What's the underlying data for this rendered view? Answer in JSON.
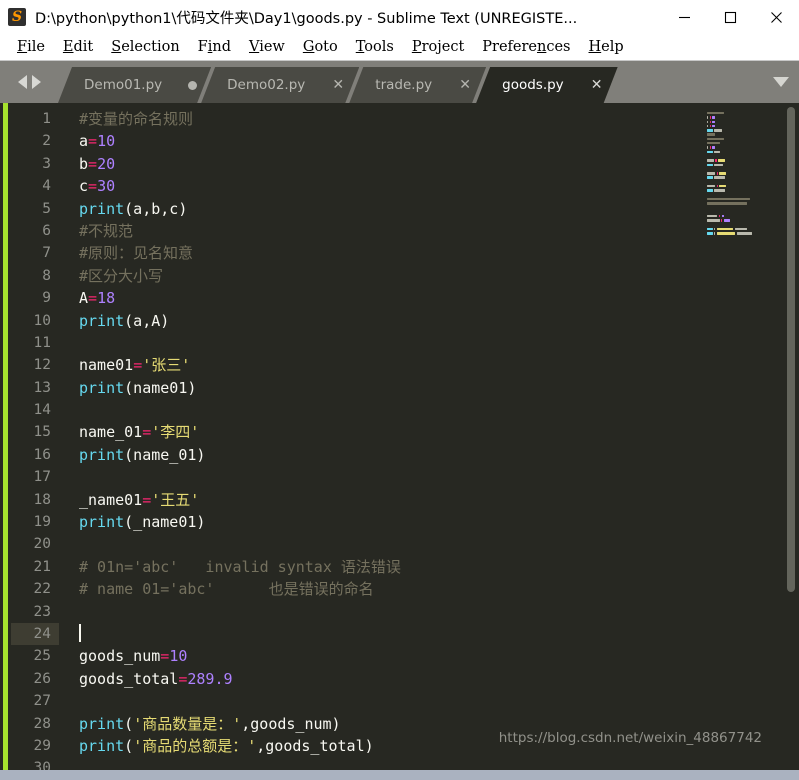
{
  "window": {
    "title": "D:\\python\\python1\\代码文件夹\\Day1\\goods.py - Sublime Text (UNREGISTE...",
    "app_icon": "sublime-text-icon",
    "icon_letter": "S",
    "controls": {
      "minimize": "minimize-icon",
      "maximize": "maximize-icon",
      "close": "close-icon"
    }
  },
  "menubar": {
    "items": [
      {
        "label": "File",
        "mnemonic": "F"
      },
      {
        "label": "Edit",
        "mnemonic": "E"
      },
      {
        "label": "Selection",
        "mnemonic": "S"
      },
      {
        "label": "Find",
        "mnemonic": "i"
      },
      {
        "label": "View",
        "mnemonic": "V"
      },
      {
        "label": "Goto",
        "mnemonic": "G"
      },
      {
        "label": "Tools",
        "mnemonic": "T"
      },
      {
        "label": "Project",
        "mnemonic": "P"
      },
      {
        "label": "Preferences",
        "mnemonic": "n"
      },
      {
        "label": "Help",
        "mnemonic": "H"
      }
    ]
  },
  "tabbar": {
    "nav_prev": "arrow-left-icon",
    "nav_next": "arrow-right-icon",
    "overflow_menu": "chevron-down-icon",
    "tabs": [
      {
        "label": "Demo01.py",
        "active": false,
        "dirty": true,
        "close": ""
      },
      {
        "label": "Demo02.py",
        "active": false,
        "dirty": false,
        "close": "✕"
      },
      {
        "label": "trade.py",
        "active": false,
        "dirty": false,
        "close": "✕"
      },
      {
        "label": "goods.py",
        "active": true,
        "dirty": false,
        "close": "✕"
      }
    ]
  },
  "editor": {
    "language": "Python",
    "cursor_line": 24,
    "first_visible_line": 1,
    "last_visible_line": 30,
    "colors": {
      "background": "#272822",
      "gutter_text": "#8f908a",
      "current_line_gutter": "#3e3d32",
      "accent_green": "#a6e22e",
      "comment": "#75715e",
      "function": "#66d9ef",
      "number": "#ae81ff",
      "operator": "#f92672",
      "string": "#e6db74",
      "text": "#f8f8f2"
    },
    "lines": [
      {
        "n": 1,
        "tokens": [
          {
            "t": "#变量的命名规则",
            "c": "c-com"
          }
        ]
      },
      {
        "n": 2,
        "tokens": [
          {
            "t": "a",
            "c": "c-var"
          },
          {
            "t": "=",
            "c": "c-op"
          },
          {
            "t": "10",
            "c": "c-num"
          }
        ]
      },
      {
        "n": 3,
        "tokens": [
          {
            "t": "b",
            "c": "c-var"
          },
          {
            "t": "=",
            "c": "c-op"
          },
          {
            "t": "20",
            "c": "c-num"
          }
        ]
      },
      {
        "n": 4,
        "tokens": [
          {
            "t": "c",
            "c": "c-var"
          },
          {
            "t": "=",
            "c": "c-op"
          },
          {
            "t": "30",
            "c": "c-num"
          }
        ]
      },
      {
        "n": 5,
        "tokens": [
          {
            "t": "print",
            "c": "c-fn"
          },
          {
            "t": "(a,b,c)",
            "c": "c-var"
          }
        ]
      },
      {
        "n": 6,
        "tokens": [
          {
            "t": "#不规范",
            "c": "c-com"
          }
        ]
      },
      {
        "n": 7,
        "tokens": [
          {
            "t": "#原则：见名知意",
            "c": "c-com"
          }
        ]
      },
      {
        "n": 8,
        "tokens": [
          {
            "t": "#区分大小写",
            "c": "c-com"
          }
        ]
      },
      {
        "n": 9,
        "tokens": [
          {
            "t": "A",
            "c": "c-var"
          },
          {
            "t": "=",
            "c": "c-op"
          },
          {
            "t": "18",
            "c": "c-num"
          }
        ]
      },
      {
        "n": 10,
        "tokens": [
          {
            "t": "print",
            "c": "c-fn"
          },
          {
            "t": "(a,A)",
            "c": "c-var"
          }
        ]
      },
      {
        "n": 11,
        "tokens": []
      },
      {
        "n": 12,
        "tokens": [
          {
            "t": "name01",
            "c": "c-var"
          },
          {
            "t": "=",
            "c": "c-op"
          },
          {
            "t": "'张三'",
            "c": "c-str"
          }
        ]
      },
      {
        "n": 13,
        "tokens": [
          {
            "t": "print",
            "c": "c-fn"
          },
          {
            "t": "(name01)",
            "c": "c-var"
          }
        ]
      },
      {
        "n": 14,
        "tokens": []
      },
      {
        "n": 15,
        "tokens": [
          {
            "t": "name_01",
            "c": "c-var"
          },
          {
            "t": "=",
            "c": "c-op"
          },
          {
            "t": "'李四'",
            "c": "c-str"
          }
        ]
      },
      {
        "n": 16,
        "tokens": [
          {
            "t": "print",
            "c": "c-fn"
          },
          {
            "t": "(name_01)",
            "c": "c-var"
          }
        ]
      },
      {
        "n": 17,
        "tokens": []
      },
      {
        "n": 18,
        "tokens": [
          {
            "t": "_name01",
            "c": "c-var"
          },
          {
            "t": "=",
            "c": "c-op"
          },
          {
            "t": "'王五'",
            "c": "c-str"
          }
        ]
      },
      {
        "n": 19,
        "tokens": [
          {
            "t": "print",
            "c": "c-fn"
          },
          {
            "t": "(_name01)",
            "c": "c-var"
          }
        ]
      },
      {
        "n": 20,
        "tokens": []
      },
      {
        "n": 21,
        "tokens": [
          {
            "t": "# 01n='abc'   invalid syntax 语法错误",
            "c": "c-com"
          }
        ]
      },
      {
        "n": 22,
        "tokens": [
          {
            "t": "# name 01='abc'      也是错误的命名",
            "c": "c-com"
          }
        ]
      },
      {
        "n": 23,
        "tokens": []
      },
      {
        "n": 24,
        "tokens": [],
        "current": true,
        "cursor": true
      },
      {
        "n": 25,
        "tokens": [
          {
            "t": "goods_num",
            "c": "c-var"
          },
          {
            "t": "=",
            "c": "c-op"
          },
          {
            "t": "10",
            "c": "c-num"
          }
        ]
      },
      {
        "n": 26,
        "tokens": [
          {
            "t": "goods_total",
            "c": "c-var"
          },
          {
            "t": "=",
            "c": "c-op"
          },
          {
            "t": "289.9",
            "c": "c-num"
          }
        ]
      },
      {
        "n": 27,
        "tokens": []
      },
      {
        "n": 28,
        "tokens": [
          {
            "t": "print",
            "c": "c-fn"
          },
          {
            "t": "(",
            "c": "c-var"
          },
          {
            "t": "'商品数量是：'",
            "c": "c-str"
          },
          {
            "t": ",goods_num)",
            "c": "c-var"
          }
        ]
      },
      {
        "n": 29,
        "tokens": [
          {
            "t": "print",
            "c": "c-fn"
          },
          {
            "t": "(",
            "c": "c-var"
          },
          {
            "t": "'商品的总额是：'",
            "c": "c-str"
          },
          {
            "t": ",goods_total)",
            "c": "c-var"
          }
        ]
      },
      {
        "n": 30,
        "tokens": []
      }
    ]
  },
  "minimap": {
    "visible": true,
    "scrollbar": "vertical-scrollbar"
  },
  "watermark": {
    "text": "https://blog.csdn.net/weixin_48867742"
  },
  "statusbar": {
    "visible": true
  }
}
